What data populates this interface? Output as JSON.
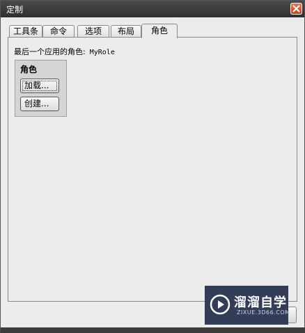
{
  "window": {
    "title": "定制"
  },
  "tabs": [
    {
      "label": "工具条"
    },
    {
      "label": "命令"
    },
    {
      "label": "选项"
    },
    {
      "label": "布局"
    },
    {
      "label": "角色",
      "active": true
    }
  ],
  "roles": {
    "last_applied_label": "最后一个应用的角色:",
    "last_applied_value": "MyRole",
    "group_title": "角色",
    "load_button": "加载...",
    "create_button": "创建..."
  },
  "watermark": {
    "main": "溜溜自学",
    "sub": "ZIXUE.3D66.COM"
  },
  "colors": {
    "titlebar": "#3a3a3a",
    "close": "#d0542f",
    "panel": "#ececec",
    "watermark": "#2a3450"
  }
}
